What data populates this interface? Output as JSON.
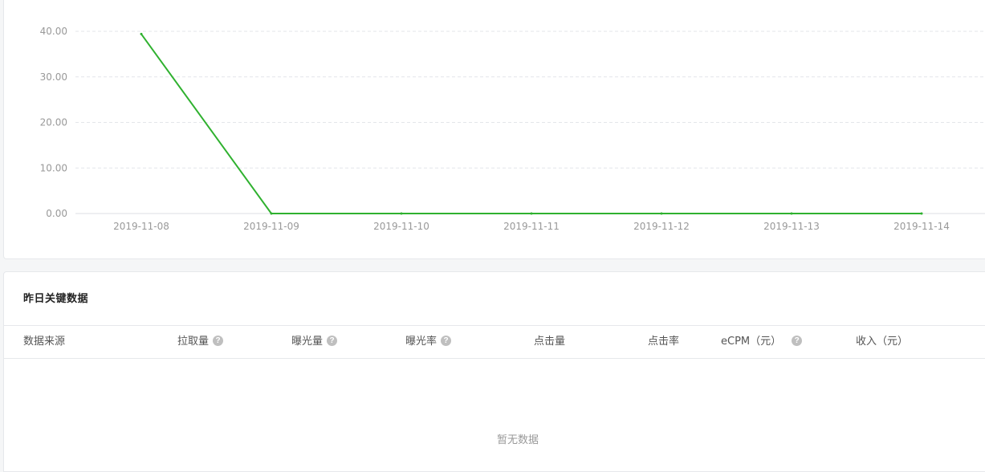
{
  "chart_data": {
    "type": "line",
    "x": [
      "2019-11-08",
      "2019-11-09",
      "2019-11-10",
      "2019-11-11",
      "2019-11-12",
      "2019-11-13",
      "2019-11-14"
    ],
    "series": [
      {
        "values": [
          39.4,
          0,
          0,
          0,
          0,
          0,
          0
        ],
        "color": "#2fb12f"
      }
    ],
    "yticks": [
      "0.00",
      "10.00",
      "20.00",
      "30.00",
      "40.00"
    ],
    "ylim": [
      0,
      40
    ],
    "grid": true,
    "grid_style": "dashed"
  },
  "table_card": {
    "title": "昨日关键数据",
    "columns": [
      {
        "label": "数据来源",
        "help": false
      },
      {
        "label": "拉取量",
        "help": true
      },
      {
        "label": "曝光量",
        "help": true
      },
      {
        "label": "曝光率",
        "help": true
      },
      {
        "label": "点击量",
        "help": false
      },
      {
        "label": "点击率",
        "help": false
      },
      {
        "label": "eCPM（元）",
        "help": true
      },
      {
        "label": "收入（元）",
        "help": false
      }
    ],
    "help_glyph": "?",
    "empty_text": "暂无数据"
  }
}
